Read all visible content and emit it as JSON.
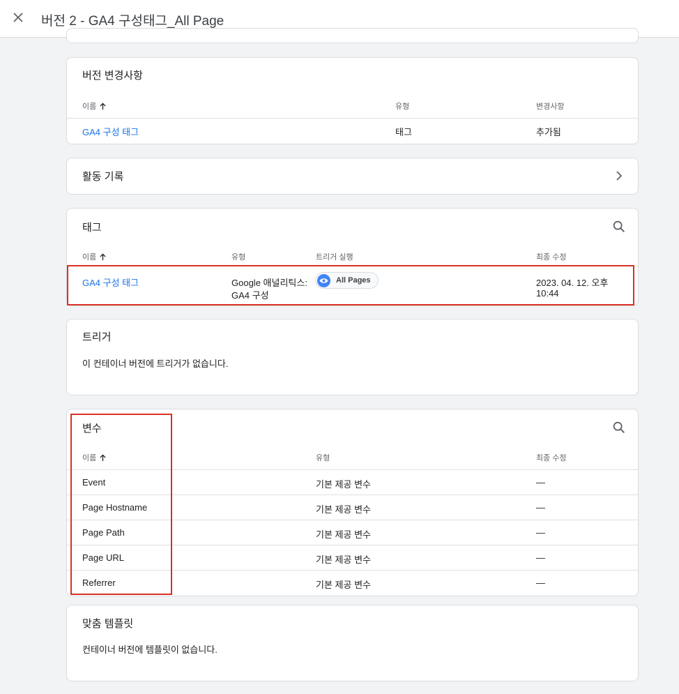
{
  "header": {
    "title": "버전 2 - GA4 구성태그_All Page"
  },
  "changes": {
    "title": "버전 변경사항",
    "col_name": "이름",
    "col_type": "유형",
    "col_change": "변경사항",
    "rows": [
      {
        "name": "GA4 구성 태그",
        "type": "태그",
        "change": "추가됨"
      }
    ]
  },
  "activity": {
    "title": "활동 기록"
  },
  "tags": {
    "title": "태그",
    "col_name": "이름",
    "col_type": "유형",
    "col_trigger": "트리거 실행",
    "col_modified": "최종 수정",
    "rows": [
      {
        "name": "GA4 구성 태그",
        "type_line1": "Google 애널리틱스:",
        "type_line2": "GA4 구성",
        "trigger": "All Pages",
        "modified_line1": "2023. 04. 12. 오후",
        "modified_line2": "10:44"
      }
    ]
  },
  "triggers": {
    "title": "트리거",
    "empty": "이 컨테이너 버전에 트리거가 없습니다."
  },
  "variables": {
    "title": "변수",
    "col_name": "이름",
    "col_type": "유형",
    "col_modified": "최종 수정",
    "rows": [
      {
        "name": "Event",
        "type": "기본 제공 변수",
        "modified": "—"
      },
      {
        "name": "Page Hostname",
        "type": "기본 제공 변수",
        "modified": "—"
      },
      {
        "name": "Page Path",
        "type": "기본 제공 변수",
        "modified": "—"
      },
      {
        "name": "Page URL",
        "type": "기본 제공 변수",
        "modified": "—"
      },
      {
        "name": "Referrer",
        "type": "기본 제공 변수",
        "modified": "—"
      }
    ]
  },
  "templates": {
    "title": "맞춤 템플릿",
    "empty": "컨테이너 버전에 템플릿이 없습니다."
  },
  "colors": {
    "link": "#1a73e8",
    "highlight": "#d93025",
    "chip_icon": "#4285f4"
  }
}
